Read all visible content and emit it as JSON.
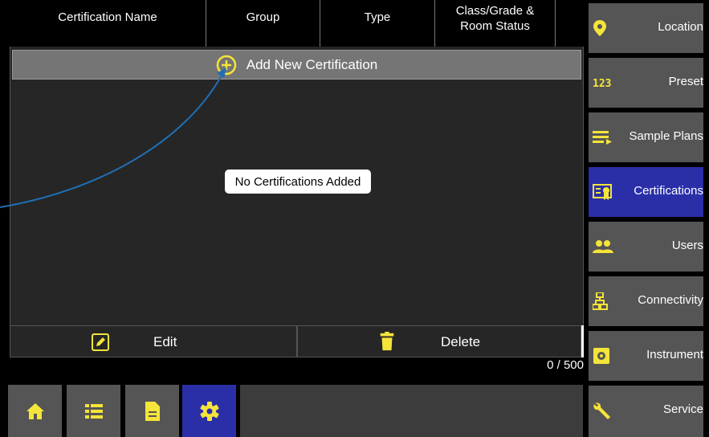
{
  "header": {
    "columns": [
      "Certification Name",
      "Group",
      "Type",
      "Class/Grade &\nRoom Status"
    ]
  },
  "content": {
    "add_button_label": "Add New Certification",
    "empty_message": "No Certifications Added"
  },
  "actions": {
    "edit_label": "Edit",
    "delete_label": "Delete"
  },
  "count_text": "0 / 500",
  "bottom_nav": {
    "items": [
      {
        "icon": "home-icon",
        "active": false
      },
      {
        "icon": "list-icon",
        "active": false
      },
      {
        "icon": "document-icon",
        "active": false
      },
      {
        "icon": "gear-icon",
        "active": true
      }
    ]
  },
  "side_nav": {
    "items": [
      {
        "label": "Location",
        "icon": "location-pin-icon",
        "active": false
      },
      {
        "label": "Preset",
        "icon": "preset-123-icon",
        "active": false
      },
      {
        "label": "Sample Plans",
        "icon": "sample-plans-icon",
        "active": false
      },
      {
        "label": "Certifications",
        "icon": "certificate-icon",
        "active": true
      },
      {
        "label": "Users",
        "icon": "users-icon",
        "active": false
      },
      {
        "label": "Connectivity",
        "icon": "network-icon",
        "active": false
      },
      {
        "label": "Instrument",
        "icon": "instrument-icon",
        "active": false
      },
      {
        "label": "Service",
        "icon": "wrench-icon",
        "active": false
      }
    ]
  },
  "colors": {
    "accent_yellow": "#f5e43a",
    "active_blue": "#2a2fa8",
    "callout_line": "#1f6fb5"
  }
}
